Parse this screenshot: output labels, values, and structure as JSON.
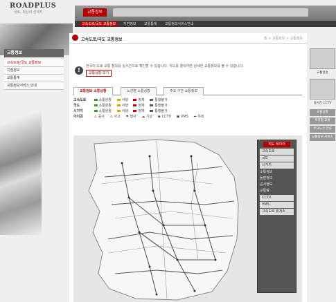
{
  "header": {
    "logo": "ROADPLUS",
    "logo_sub": "국토, 최상의 선택지",
    "top_tabs": [
      "교통정보",
      "",
      "",
      "",
      "",
      ""
    ],
    "sub_nav": [
      "고속도로/국도 교통정보",
      "지점정보",
      "교통통계",
      "교통정보서비스안내"
    ]
  },
  "sidebar": {
    "title": "교통정보",
    "items": [
      "고속도로/국도 교통정보",
      "지점정보",
      "교통통계",
      "교통정보서비스 안내"
    ]
  },
  "content": {
    "breadcrumb_title": "고속도로/국도 교통정보",
    "breadcrumb_path": "홈 > 교통정보 > 교통정보",
    "info_text": "전국의 도로 교통 정보를 실시간으로 확인할 수 있습니다. 지도를 클릭하면 상세한 교통정보를 볼 수 있습니다.",
    "info_button": "교통상황 보기",
    "tabs": [
      "교통정보 소통상황",
      "노선별 소통상황",
      "주요 구간 소통정보"
    ],
    "legend": [
      {
        "head": "고속도로",
        "items": [
          "소통원활",
          "서행",
          "정체",
          "통행불가"
        ]
      },
      {
        "head": "국도",
        "items": [
          "소통원활",
          "서행",
          "정체",
          "통행불가"
        ]
      },
      {
        "head": "시가지",
        "items": [
          "소통원활",
          "서행",
          "정체",
          "통행불가"
        ]
      },
      {
        "head": "아이콘",
        "items": [
          "공사",
          "사고",
          "행사",
          "기상",
          "CCTV",
          "VMS",
          "우회"
        ]
      }
    ]
  },
  "map": {
    "panel_title": "지도 레이어",
    "panel_items": [
      "고속도로",
      "국도",
      "시가지",
      "소통정보",
      "돌발정보",
      "공사정보",
      "교통량",
      "CCTV",
      "VMS",
      "고속도로 휴게소"
    ]
  },
  "rail": {
    "items": [
      "교통방송",
      "실시간 CCTV",
      "교통상황",
      "지역별 교통",
      "주요노선 안내",
      "교통정보 서비스"
    ]
  },
  "colors": {
    "accent": "#b80000",
    "smooth": "#3a9a3a",
    "slow": "#e0a000",
    "jam": "#d00000"
  }
}
